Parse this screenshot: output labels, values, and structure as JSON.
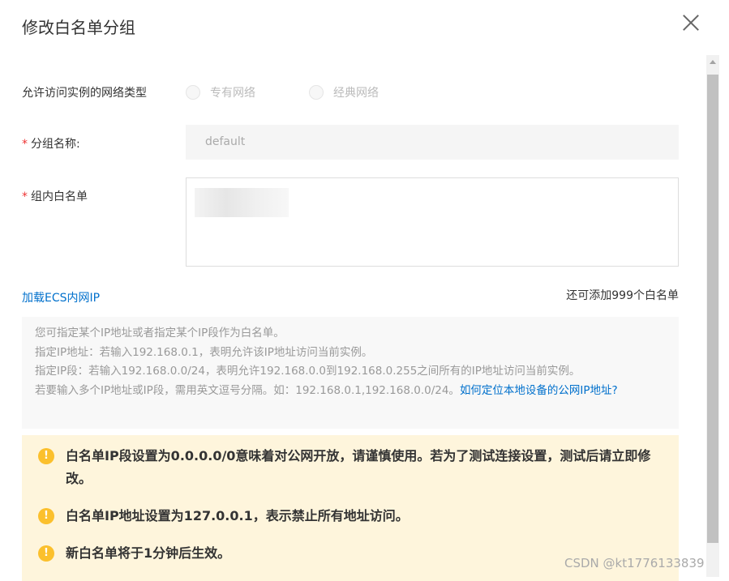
{
  "dialog": {
    "title": "修改白名单分组"
  },
  "network": {
    "label": "允许访问实例的网络类型",
    "options": [
      "专有网络",
      "经典网络"
    ]
  },
  "group_name": {
    "required": "*",
    "label": "分组名称:",
    "value": "default"
  },
  "whitelist": {
    "required": "*",
    "label": "组内白名单"
  },
  "load_ecs": "加载ECS内网IP",
  "remaining": "还可添加999个白名单",
  "tips": {
    "lines": [
      "您可指定某个IP地址或者指定某个IP段作为白名单。",
      "指定IP地址：若输入192.168.0.1，表明允许该IP地址访问当前实例。",
      "指定IP段：若输入192.168.0.0/24，表明允许192.168.0.0到192.168.0.255之间所有的IP地址访问当前实例。",
      "若要输入多个IP地址或IP段，需用英文逗号分隔。如：192.168.0.1,192.168.0.0/24。"
    ],
    "link": "如何定位本地设备的公网IP地址?"
  },
  "warnings": [
    "白名单IP段设置为0.0.0.0/0意味着对公网开放，请谨慎使用。若为了测试连接设置，测试后请立即修改。",
    "白名单IP地址设置为127.0.0.1，表示禁止所有地址访问。",
    "新白名单将于1分钟后生效。"
  ],
  "warning_icon": "!",
  "watermark": "CSDN @kt1776133839"
}
